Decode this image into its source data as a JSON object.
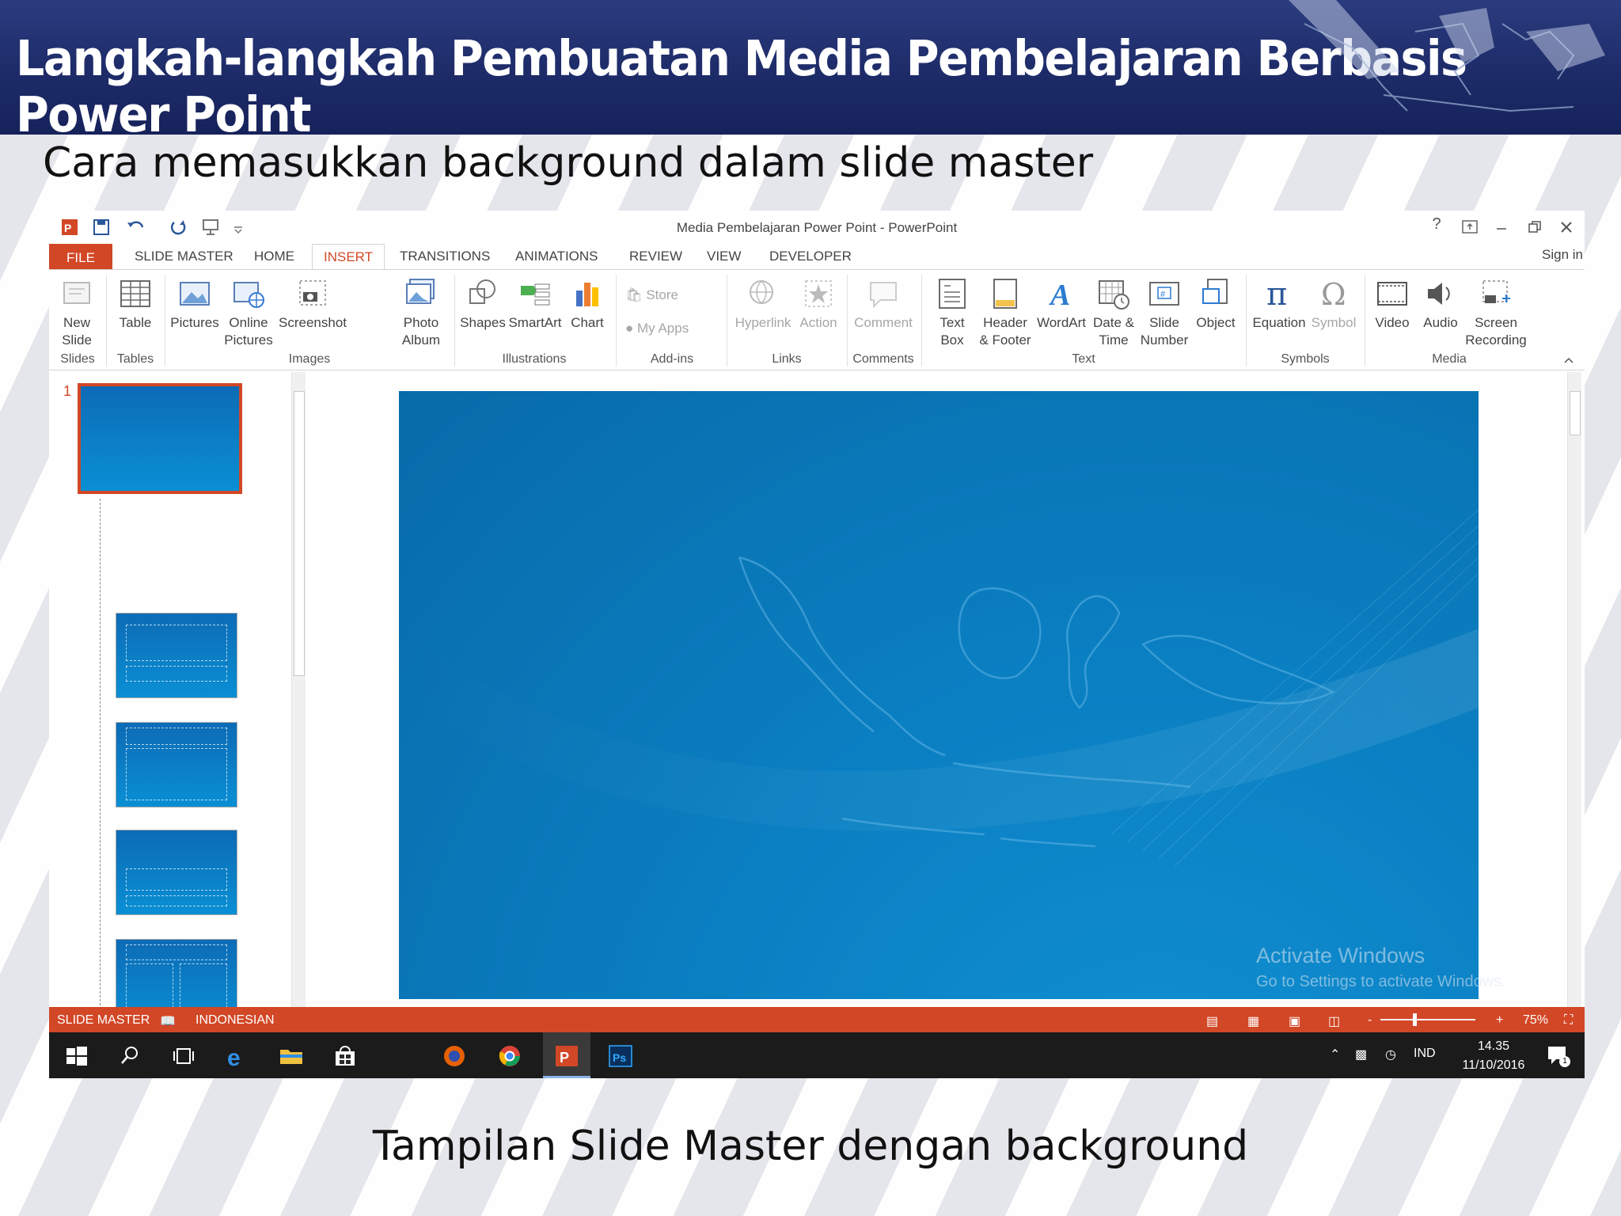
{
  "banner": {
    "title": "Langkah-langkah Pembuatan Media Pembelajaran Berbasis Power Point"
  },
  "subtitle": "Cara memasukkan background dalam slide master",
  "caption": "Tampilan Slide Master dengan background",
  "window": {
    "title": "Media Pembelajaran Power Point - PowerPoint",
    "help": "?",
    "sign_in": "Sign in"
  },
  "tabs": [
    "FILE",
    "SLIDE MASTER",
    "HOME",
    "INSERT",
    "TRANSITIONS",
    "ANIMATIONS",
    "REVIEW",
    "VIEW",
    "DEVELOPER"
  ],
  "active_tab": "INSERT",
  "ribbon": {
    "slides": {
      "new_slide_1": "New",
      "new_slide_2": "Slide",
      "group": "Slides"
    },
    "tables": {
      "table": "Table",
      "group": "Tables"
    },
    "images": {
      "pictures": "Pictures",
      "online_1": "Online",
      "online_2": "Pictures",
      "screenshot": "Screenshot",
      "photo_1": "Photo",
      "photo_2": "Album",
      "group": "Images"
    },
    "illustrations": {
      "shapes": "Shapes",
      "smartart": "SmartArt",
      "chart": "Chart",
      "group": "Illustrations"
    },
    "addins": {
      "store": "Store",
      "myapps": "My Apps",
      "group": "Add-ins"
    },
    "links": {
      "hyperlink": "Hyperlink",
      "action": "Action",
      "group": "Links"
    },
    "comments": {
      "comment": "Comment",
      "group": "Comments"
    },
    "text": {
      "textbox_1": "Text",
      "textbox_2": "Box",
      "header_1": "Header",
      "header_2": "& Footer",
      "wordart": "WordArt",
      "date_1": "Date &",
      "date_2": "Time",
      "slidenum_1": "Slide",
      "slidenum_2": "Number",
      "object": "Object",
      "group": "Text"
    },
    "symbols": {
      "equation": "Equation",
      "symbol": "Symbol",
      "group": "Symbols"
    },
    "media": {
      "video": "Video",
      "audio": "Audio",
      "screen_1": "Screen",
      "screen_2": "Recording",
      "group": "Media"
    }
  },
  "thumbnails": {
    "first_number": "1"
  },
  "watermark": {
    "line1": "Activate Windows",
    "line2": "Go to Settings to activate Windows."
  },
  "status": {
    "mode": "SLIDE MASTER",
    "language": "INDONESIAN",
    "zoom": "75%",
    "zoom_level": 0.75
  },
  "taskbar": {
    "lang": "IND",
    "time": "14.35",
    "date": "11/10/2016",
    "notif": "1"
  },
  "colors": {
    "ppt_accent": "#d24726",
    "banner": "#1d2b68",
    "slide_blue": "#0a7fc2"
  }
}
